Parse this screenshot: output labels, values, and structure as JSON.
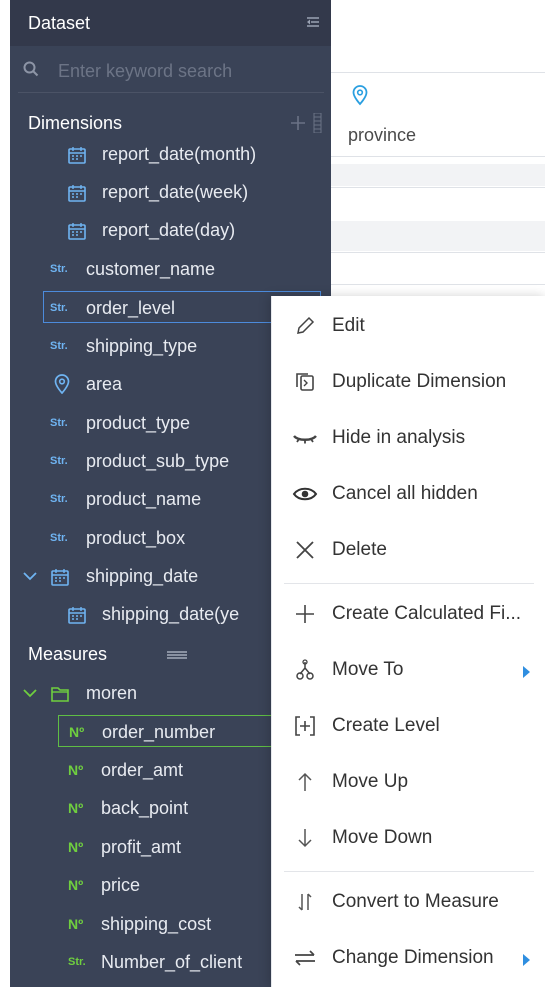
{
  "panel": {
    "title": "Dataset",
    "search_placeholder": "Enter keyword search",
    "dimensions_label": "Dimensions",
    "dimensions": [
      {
        "type": "date",
        "label": "report_date(month)"
      },
      {
        "type": "date",
        "label": "report_date(week)"
      },
      {
        "type": "date",
        "label": "report_date(day)"
      },
      {
        "type": "str",
        "badge": "Str.",
        "label": "customer_name"
      },
      {
        "type": "str",
        "badge": "Str.",
        "label": "order_level",
        "selected": true
      },
      {
        "type": "str",
        "badge": "Str.",
        "label": "shipping_type"
      },
      {
        "type": "geo",
        "label": "area"
      },
      {
        "type": "str",
        "badge": "Str.",
        "label": "product_type"
      },
      {
        "type": "str",
        "badge": "Str.",
        "label": "product_sub_type"
      },
      {
        "type": "str",
        "badge": "Str.",
        "label": "product_name"
      },
      {
        "type": "str",
        "badge": "Str.",
        "label": "product_box"
      },
      {
        "type": "date-group",
        "label": "shipping_date",
        "expanded": true
      },
      {
        "type": "date",
        "label": "shipping_date(ye"
      }
    ],
    "measures_label": "Measures",
    "measures_folder": "moren",
    "measures": [
      {
        "badge": "Nº",
        "label": "order_number",
        "selected": true
      },
      {
        "badge": "Nº",
        "label": "order_amt"
      },
      {
        "badge": "Nº",
        "label": "back_point"
      },
      {
        "badge": "Nº",
        "label": "profit_amt"
      },
      {
        "badge": "Nº",
        "label": "price"
      },
      {
        "badge": "Nº",
        "label": "shipping_cost"
      },
      {
        "badge": "Str.",
        "label": "Number_of_client"
      }
    ],
    "colors": {
      "panel_bg": "#3a4357",
      "str_badge": "#6fb4f2",
      "num_badge": "#6fcf3f",
      "selection_blue": "#4c8bdc",
      "selection_green": "#5fbe44"
    }
  },
  "canvas": {
    "field_label": "province",
    "field_icon": "location-pin-icon"
  },
  "context_menu": {
    "items": [
      {
        "icon": "edit-pencil-icon",
        "label": "Edit"
      },
      {
        "icon": "duplicate-icon",
        "label": "Duplicate Dimension"
      },
      {
        "icon": "hide-eye-closed-icon",
        "label": "Hide in analysis"
      },
      {
        "icon": "eye-icon",
        "label": "Cancel all hidden"
      },
      {
        "icon": "close-x-icon",
        "label": "Delete"
      },
      {
        "icon": "plus-icon",
        "label": "Create Calculated Fi..."
      },
      {
        "icon": "move-to-icon",
        "label": "Move To",
        "submenu": true
      },
      {
        "icon": "create-level-icon",
        "label": "Create Level"
      },
      {
        "icon": "arrow-up-icon",
        "label": "Move Up"
      },
      {
        "icon": "arrow-down-icon",
        "label": "Move Down"
      },
      {
        "icon": "convert-arrows-icon",
        "label": "Convert to Measure"
      },
      {
        "icon": "swap-arrows-icon",
        "label": "Change Dimension",
        "submenu": true
      }
    ]
  }
}
